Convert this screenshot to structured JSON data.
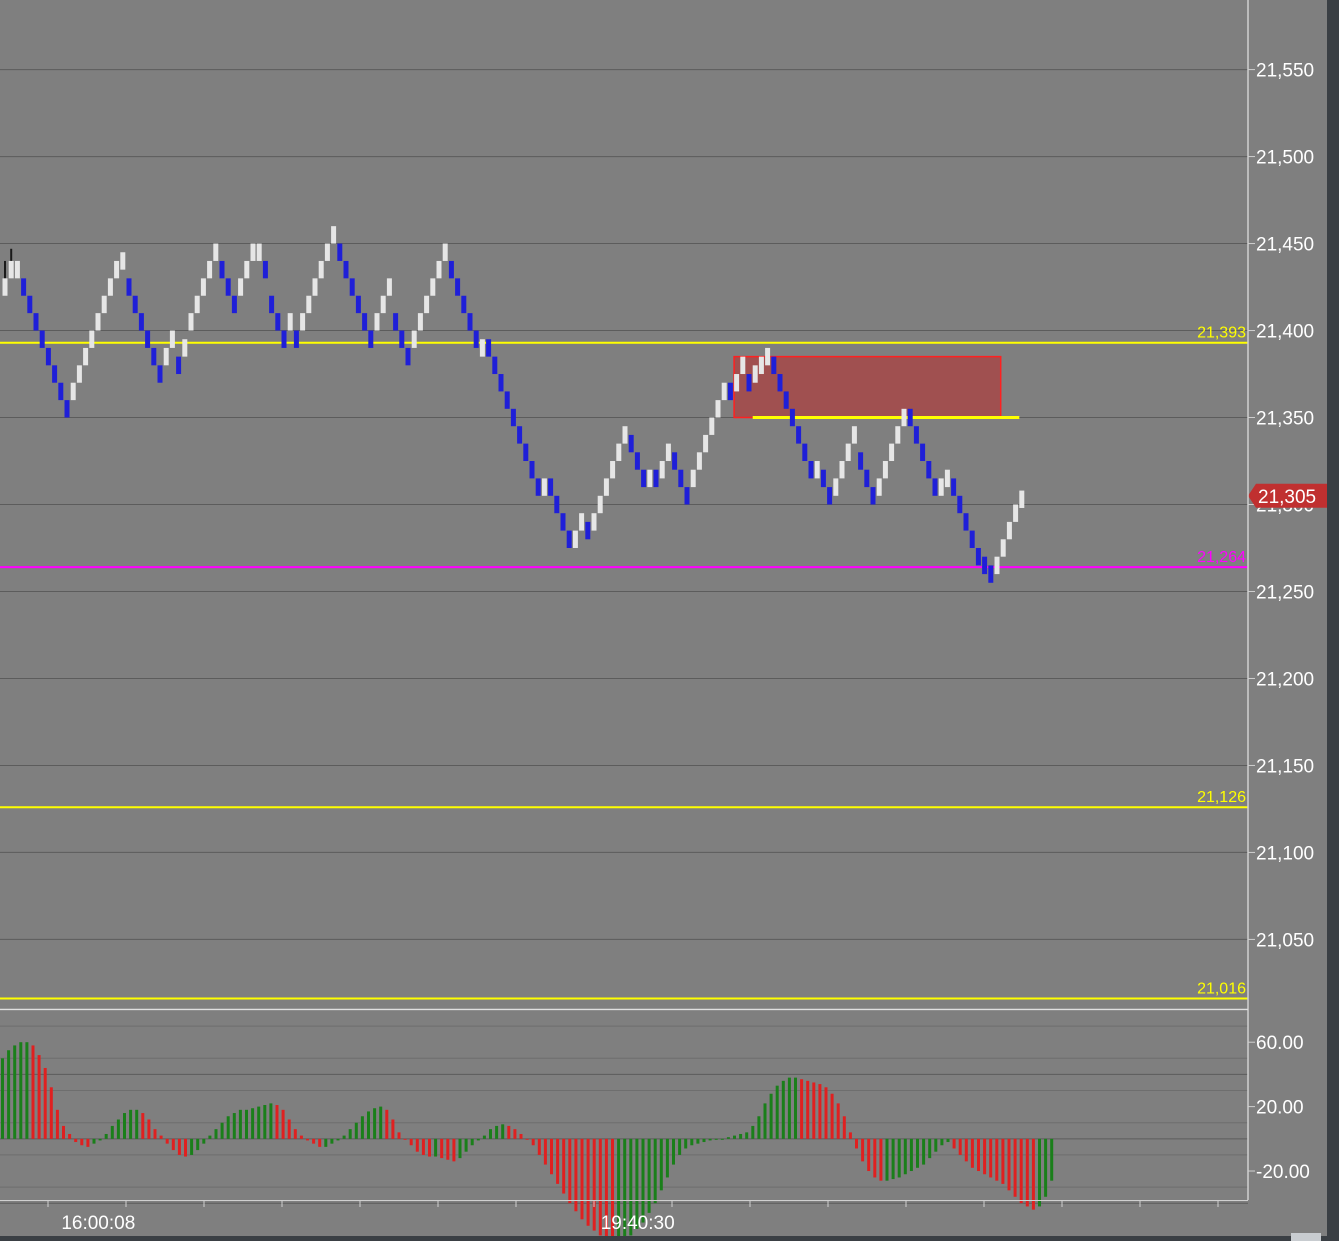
{
  "colors": {
    "background": "#7f7f7f",
    "grid": "#5c5c5c",
    "axis_line": "#d0d0d0",
    "up_brick": "#e6e6e6",
    "down_brick": "#1f1fd8",
    "wick": "#1a1a1a",
    "level_yellow": "#ffff00",
    "level_magenta": "#ff00ff",
    "zone_fill": "#a05050",
    "zone_border": "#ff2020",
    "price_tag": "#c03030",
    "hist_pos": "#1a7f1a",
    "hist_neg": "#e02020"
  },
  "chart_data": [
    {
      "type": "renko",
      "brick_size": 10,
      "ylim": [
        21010,
        21590
      ],
      "price_ticks": [
        "21,550",
        "21,500",
        "21,450",
        "21,400",
        "21,350",
        "21,300",
        "21,250",
        "21,200",
        "21,150",
        "21,100",
        "21,050"
      ],
      "price_tick_values": [
        21550,
        21500,
        21450,
        21400,
        21350,
        21300,
        21250,
        21200,
        21150,
        21100,
        21050
      ],
      "time_labels": [
        {
          "label": "16:00:08",
          "bar": 9
        },
        {
          "label": "19:40:30",
          "bar": 96
        }
      ],
      "bricks": [
        {
          "dir": 1,
          "close": 21430,
          "wick": 21440
        },
        {
          "dir": 1,
          "close": 21440,
          "wick": 21447
        },
        {
          "dir": 1,
          "close": 21440
        },
        {
          "dir": -1,
          "close": 21420
        },
        {
          "dir": -1,
          "close": 21410
        },
        {
          "dir": -1,
          "close": 21400
        },
        {
          "dir": -1,
          "close": 21390
        },
        {
          "dir": -1,
          "close": 21380
        },
        {
          "dir": -1,
          "close": 21370
        },
        {
          "dir": -1,
          "close": 21360
        },
        {
          "dir": -1,
          "close": 21350
        },
        {
          "dir": 1,
          "close": 21370
        },
        {
          "dir": 1,
          "close": 21380
        },
        {
          "dir": 1,
          "close": 21390
        },
        {
          "dir": 1,
          "close": 21400
        },
        {
          "dir": 1,
          "close": 21410
        },
        {
          "dir": 1,
          "close": 21420
        },
        {
          "dir": 1,
          "close": 21430
        },
        {
          "dir": 1,
          "close": 21440
        },
        {
          "dir": 1,
          "close": 21445
        },
        {
          "dir": -1,
          "close": 21420
        },
        {
          "dir": -1,
          "close": 21410
        },
        {
          "dir": -1,
          "close": 21400
        },
        {
          "dir": -1,
          "close": 21390
        },
        {
          "dir": -1,
          "close": 21380
        },
        {
          "dir": -1,
          "close": 21370
        },
        {
          "dir": 1,
          "close": 21390
        },
        {
          "dir": 1,
          "close": 21400
        },
        {
          "dir": -1,
          "close": 21375
        },
        {
          "dir": 1,
          "close": 21395
        },
        {
          "dir": 1,
          "close": 21410
        },
        {
          "dir": 1,
          "close": 21420
        },
        {
          "dir": 1,
          "close": 21430
        },
        {
          "dir": 1,
          "close": 21440
        },
        {
          "dir": 1,
          "close": 21450
        },
        {
          "dir": -1,
          "close": 21430
        },
        {
          "dir": -1,
          "close": 21420
        },
        {
          "dir": -1,
          "close": 21410
        },
        {
          "dir": 1,
          "close": 21430
        },
        {
          "dir": 1,
          "close": 21440
        },
        {
          "dir": 1,
          "close": 21450
        },
        {
          "dir": 1,
          "close": 21450
        },
        {
          "dir": -1,
          "close": 21430
        },
        {
          "dir": -1,
          "close": 21410
        },
        {
          "dir": -1,
          "close": 21400
        },
        {
          "dir": -1,
          "close": 21390
        },
        {
          "dir": 1,
          "close": 21410
        },
        {
          "dir": -1,
          "close": 21390
        },
        {
          "dir": 1,
          "close": 21410
        },
        {
          "dir": 1,
          "close": 21420
        },
        {
          "dir": 1,
          "close": 21430
        },
        {
          "dir": 1,
          "close": 21440
        },
        {
          "dir": 1,
          "close": 21450
        },
        {
          "dir": 1,
          "close": 21460
        },
        {
          "dir": -1,
          "close": 21440
        },
        {
          "dir": -1,
          "close": 21430
        },
        {
          "dir": -1,
          "close": 21420
        },
        {
          "dir": -1,
          "close": 21410
        },
        {
          "dir": -1,
          "close": 21400
        },
        {
          "dir": -1,
          "close": 21390
        },
        {
          "dir": 1,
          "close": 21410
        },
        {
          "dir": 1,
          "close": 21420
        },
        {
          "dir": 1,
          "close": 21430
        },
        {
          "dir": -1,
          "close": 21400
        },
        {
          "dir": -1,
          "close": 21390
        },
        {
          "dir": -1,
          "close": 21380
        },
        {
          "dir": 1,
          "close": 21400
        },
        {
          "dir": 1,
          "close": 21410
        },
        {
          "dir": 1,
          "close": 21420
        },
        {
          "dir": 1,
          "close": 21430
        },
        {
          "dir": 1,
          "close": 21440
        },
        {
          "dir": 1,
          "close": 21450
        },
        {
          "dir": -1,
          "close": 21430
        },
        {
          "dir": -1,
          "close": 21420
        },
        {
          "dir": -1,
          "close": 21410
        },
        {
          "dir": -1,
          "close": 21400
        },
        {
          "dir": -1,
          "close": 21390
        },
        {
          "dir": 1,
          "close": 21395
        },
        {
          "dir": -1,
          "close": 21385
        },
        {
          "dir": -1,
          "close": 21375
        },
        {
          "dir": -1,
          "close": 21365
        },
        {
          "dir": -1,
          "close": 21355
        },
        {
          "dir": -1,
          "close": 21345
        },
        {
          "dir": -1,
          "close": 21335
        },
        {
          "dir": -1,
          "close": 21325
        },
        {
          "dir": -1,
          "close": 21315
        },
        {
          "dir": -1,
          "close": 21305
        },
        {
          "dir": 1,
          "close": 21315
        },
        {
          "dir": -1,
          "close": 21305
        },
        {
          "dir": -1,
          "close": 21295
        },
        {
          "dir": -1,
          "close": 21285
        },
        {
          "dir": -1,
          "close": 21275
        },
        {
          "dir": 1,
          "close": 21285
        },
        {
          "dir": 1,
          "close": 21295
        },
        {
          "dir": -1,
          "close": 21280
        },
        {
          "dir": 1,
          "close": 21295
        },
        {
          "dir": 1,
          "close": 21305
        },
        {
          "dir": 1,
          "close": 21315
        },
        {
          "dir": 1,
          "close": 21325
        },
        {
          "dir": 1,
          "close": 21335
        },
        {
          "dir": 1,
          "close": 21345
        },
        {
          "dir": -1,
          "close": 21330
        },
        {
          "dir": -1,
          "close": 21320
        },
        {
          "dir": -1,
          "close": 21310
        },
        {
          "dir": 1,
          "close": 21320
        },
        {
          "dir": -1,
          "close": 21310
        },
        {
          "dir": 1,
          "close": 21325
        },
        {
          "dir": 1,
          "close": 21335
        },
        {
          "dir": -1,
          "close": 21320
        },
        {
          "dir": -1,
          "close": 21310
        },
        {
          "dir": -1,
          "close": 21300
        },
        {
          "dir": 1,
          "close": 21320
        },
        {
          "dir": 1,
          "close": 21330
        },
        {
          "dir": 1,
          "close": 21340
        },
        {
          "dir": 1,
          "close": 21350
        },
        {
          "dir": 1,
          "close": 21360
        },
        {
          "dir": 1,
          "close": 21370
        },
        {
          "dir": -1,
          "close": 21360
        },
        {
          "dir": 1,
          "close": 21375
        },
        {
          "dir": 1,
          "close": 21385
        },
        {
          "dir": -1,
          "close": 21365
        },
        {
          "dir": 1,
          "close": 21380
        },
        {
          "dir": 1,
          "close": 21385
        },
        {
          "dir": 1,
          "close": 21390
        },
        {
          "dir": -1,
          "close": 21375
        },
        {
          "dir": -1,
          "close": 21365
        },
        {
          "dir": -1,
          "close": 21355
        },
        {
          "dir": -1,
          "close": 21345
        },
        {
          "dir": -1,
          "close": 21335
        },
        {
          "dir": -1,
          "close": 21325
        },
        {
          "dir": -1,
          "close": 21315
        },
        {
          "dir": 1,
          "close": 21325
        },
        {
          "dir": -1,
          "close": 21310
        },
        {
          "dir": -1,
          "close": 21300
        },
        {
          "dir": 1,
          "close": 21315
        },
        {
          "dir": 1,
          "close": 21325
        },
        {
          "dir": 1,
          "close": 21335
        },
        {
          "dir": 1,
          "close": 21345
        },
        {
          "dir": -1,
          "close": 21320
        },
        {
          "dir": -1,
          "close": 21310
        },
        {
          "dir": -1,
          "close": 21300
        },
        {
          "dir": 1,
          "close": 21315
        },
        {
          "dir": 1,
          "close": 21325
        },
        {
          "dir": 1,
          "close": 21335
        },
        {
          "dir": 1,
          "close": 21345
        },
        {
          "dir": 1,
          "close": 21355
        },
        {
          "dir": -1,
          "close": 21345
        },
        {
          "dir": -1,
          "close": 21335
        },
        {
          "dir": -1,
          "close": 21325
        },
        {
          "dir": -1,
          "close": 21315
        },
        {
          "dir": -1,
          "close": 21305
        },
        {
          "dir": 1,
          "close": 21315
        },
        {
          "dir": 1,
          "close": 21320
        },
        {
          "dir": -1,
          "close": 21305
        },
        {
          "dir": -1,
          "close": 21295
        },
        {
          "dir": -1,
          "close": 21285
        },
        {
          "dir": -1,
          "close": 21275
        },
        {
          "dir": -1,
          "close": 21265
        },
        {
          "dir": -1,
          "close": 21260
        },
        {
          "dir": -1,
          "close": 21255
        },
        {
          "dir": 1,
          "close": 21270
        },
        {
          "dir": 1,
          "close": 21280
        },
        {
          "dir": 1,
          "close": 21290
        },
        {
          "dir": 1,
          "close": 21300
        },
        {
          "dir": 1,
          "close": 21308
        }
      ],
      "levels": [
        {
          "label": "21,393",
          "value": 21393,
          "color": "#ffff00"
        },
        {
          "label": "21,264",
          "value": 21264,
          "color": "#ff00ff"
        },
        {
          "label": "21,126",
          "value": 21126,
          "color": "#ffff00"
        },
        {
          "label": "21,016",
          "value": 21016,
          "color": "#ffff00"
        }
      ],
      "segment_level": {
        "value": 21350,
        "from_bar": 121,
        "to_bar": 164,
        "color": "#ffff00"
      },
      "zone": {
        "top": 21385,
        "bottom": 21350,
        "from_bar": 118,
        "to_bar": 161
      },
      "last_price": {
        "label": "21,305",
        "value": 21305
      }
    },
    {
      "type": "histogram",
      "ylim": [
        -38,
        80
      ],
      "y_ticks": [
        "60.00",
        "20.00",
        "-20.00"
      ],
      "y_tick_values": [
        60,
        20,
        -20
      ],
      "values": [
        50,
        55,
        58,
        60,
        60,
        58,
        52,
        44,
        32,
        18,
        8,
        3,
        -2,
        -4,
        -5,
        -3,
        -1,
        3,
        8,
        12,
        16,
        18,
        18,
        16,
        12,
        6,
        2,
        -3,
        -7,
        -10,
        -11,
        -10,
        -7,
        -3,
        2,
        6,
        10,
        14,
        16,
        18,
        18,
        19,
        20,
        21,
        22,
        21,
        18,
        12,
        6,
        2,
        -1,
        -3,
        -5,
        -5,
        -3,
        -1,
        2,
        6,
        10,
        14,
        17,
        19,
        20,
        18,
        12,
        4,
        0,
        -4,
        -8,
        -10,
        -11,
        -11,
        -12,
        -13,
        -14,
        -12,
        -8,
        -4,
        -1,
        2,
        6,
        8,
        9,
        8,
        6,
        3,
        0,
        -4,
        -10,
        -16,
        -22,
        -28,
        -34,
        -40,
        -45,
        -50,
        -54,
        -57,
        -60,
        -62,
        -63,
        -63,
        -62,
        -60,
        -56,
        -52,
        -46,
        -40,
        -32,
        -24,
        -16,
        -10,
        -6,
        -4,
        -3,
        -2,
        -1,
        0,
        0,
        1,
        2,
        3,
        4,
        8,
        14,
        22,
        28,
        33,
        36,
        38,
        38,
        37,
        36,
        35,
        34,
        32,
        28,
        22,
        14,
        4,
        -6,
        -14,
        -20,
        -24,
        -26,
        -26,
        -25,
        -24,
        -22,
        -20,
        -18,
        -16,
        -12,
        -8,
        -4,
        -2,
        -6,
        -10,
        -14,
        -18,
        -20,
        -22,
        -24,
        -26,
        -28,
        -32,
        -36,
        -40,
        -42,
        -44,
        -42,
        -36,
        -26
      ]
    }
  ]
}
